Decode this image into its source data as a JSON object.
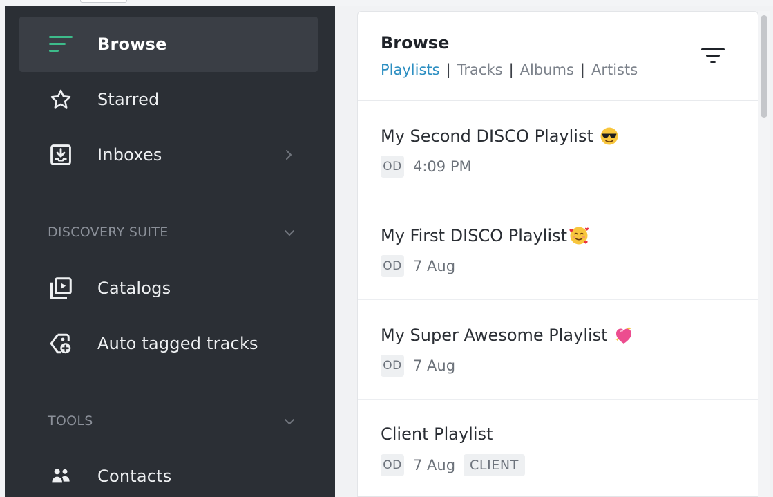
{
  "colors": {
    "sidebar_bg": "#2b2f35",
    "sidebar_active_bg": "#3a3e45",
    "accent_green": "#3dbb8a",
    "tab_active": "#2d8fc2",
    "panel_bg": "#ffffff"
  },
  "sidebar": {
    "items": [
      {
        "label": "Browse",
        "icon": "browse-lines-icon",
        "active": true
      },
      {
        "label": "Starred",
        "icon": "star-icon"
      },
      {
        "label": "Inboxes",
        "icon": "inbox-download-icon",
        "has_chevron": true
      }
    ],
    "sections": [
      {
        "label": "DISCOVERY SUITE",
        "items": [
          {
            "label": "Catalogs",
            "icon": "catalog-play-icon"
          },
          {
            "label": "Auto tagged tracks",
            "icon": "auto-tag-icon"
          }
        ]
      },
      {
        "label": "TOOLS",
        "items": [
          {
            "label": "Contacts",
            "icon": "contacts-icon"
          }
        ]
      }
    ]
  },
  "main": {
    "title": "Browse",
    "tabs": [
      {
        "label": "Playlists",
        "active": true
      },
      {
        "label": "Tracks"
      },
      {
        "label": "Albums"
      },
      {
        "label": "Artists"
      }
    ],
    "filter_icon": "filter-icon",
    "playlists": [
      {
        "title": "My Second DISCO Playlist",
        "emoji": "sunglasses-emoji",
        "owner": "OD",
        "date": "4:09 PM"
      },
      {
        "title": "My First DISCO Playlist",
        "emoji": "smiling-hearts-emoji",
        "owner": "OD",
        "date": "7 Aug"
      },
      {
        "title": "My Super Awesome Playlist",
        "emoji": "sparkling-heart-emoji",
        "owner": "OD",
        "date": "7 Aug"
      },
      {
        "title": "Client Playlist",
        "owner": "OD",
        "date": "7 Aug",
        "tag": "CLIENT"
      }
    ]
  }
}
